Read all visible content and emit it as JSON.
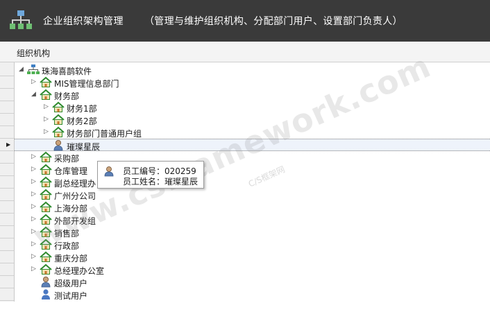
{
  "header": {
    "icon": "org-chart-icon",
    "title": "企业组织架构管理",
    "subtitle": "（管理与维护组织机构、分配部门用户、设置部门负责人）"
  },
  "panel": {
    "title": "组织机构"
  },
  "tree": {
    "nodes": [
      {
        "label": "珠海喜鹊软件",
        "icon": "org-chart-icon",
        "expander": "expanded"
      },
      {
        "label": "MIS管理信息部门",
        "icon": "house-icon",
        "expander": "collapsed"
      },
      {
        "label": "财务部",
        "icon": "house-icon",
        "expander": "expanded"
      },
      {
        "label": "财务1部",
        "icon": "house-icon",
        "expander": "collapsed"
      },
      {
        "label": "财务2部",
        "icon": "house-icon",
        "expander": "collapsed"
      },
      {
        "label": "财务部门普通用户组",
        "icon": "house-icon",
        "expander": "collapsed"
      },
      {
        "label": "璀璨星辰",
        "icon": "user-icon",
        "expander": "none",
        "selected": true
      },
      {
        "label": "采购部",
        "icon": "house-icon",
        "expander": "collapsed"
      },
      {
        "label": "仓库管理",
        "icon": "house-icon",
        "expander": "collapsed"
      },
      {
        "label": "副总经理办",
        "icon": "house-icon",
        "expander": "collapsed"
      },
      {
        "label": "广州分公司",
        "icon": "house-icon",
        "expander": "collapsed"
      },
      {
        "label": "上海分部",
        "icon": "house-icon",
        "expander": "collapsed"
      },
      {
        "label": "外部开发组",
        "icon": "house-icon",
        "expander": "collapsed"
      },
      {
        "label": "销售部",
        "icon": "house-icon",
        "expander": "collapsed"
      },
      {
        "label": "行政部",
        "icon": "house-icon",
        "expander": "collapsed"
      },
      {
        "label": "重庆分部",
        "icon": "house-icon",
        "expander": "collapsed"
      },
      {
        "label": "总经理办公室",
        "icon": "house-icon",
        "expander": "collapsed"
      },
      {
        "label": "超级用户",
        "icon": "user-icon",
        "expander": "none"
      },
      {
        "label": "测试用户",
        "icon": "user-blue-icon",
        "expander": "none"
      }
    ]
  },
  "tooltip": {
    "icon": "user-icon",
    "lines": [
      "员工编号：020259",
      "员工姓名：璀璨星辰"
    ]
  },
  "watermark": {
    "text": "www.csframework.com",
    "sub": "C/S框架网"
  },
  "colors": {
    "header_bg": "#3a3a3a",
    "selected_row": "#eef3fb",
    "house_green": "#2e8b2e"
  }
}
